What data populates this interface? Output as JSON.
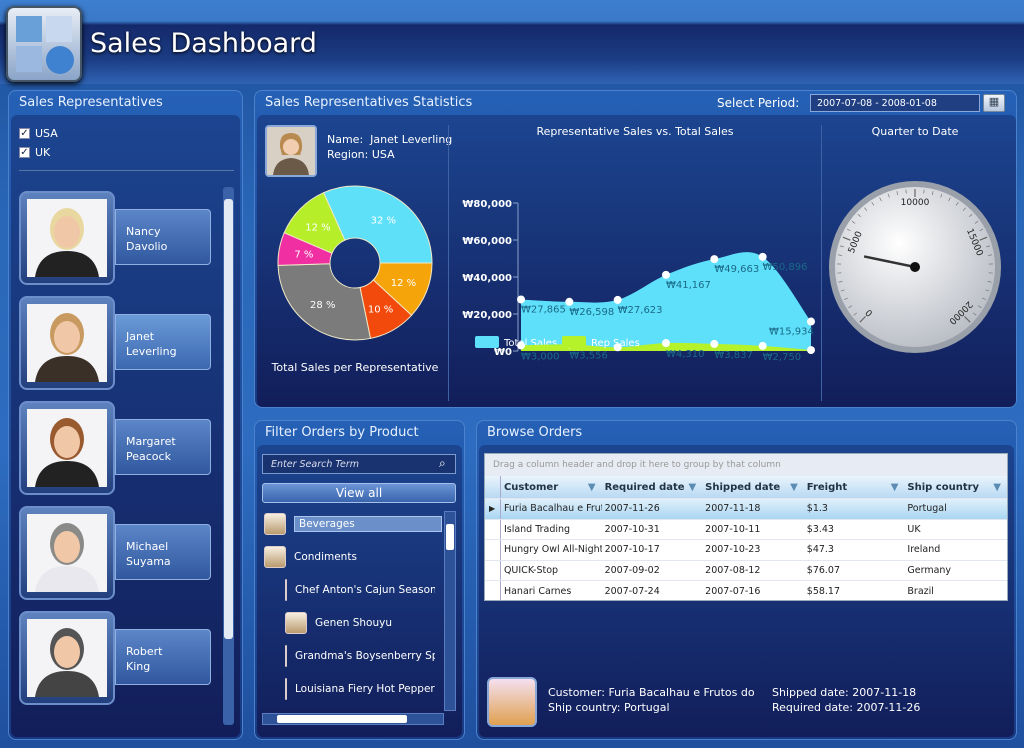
{
  "app": {
    "title": "Sales Dashboard"
  },
  "reps_panel": {
    "title": "Sales Representatives",
    "filters": [
      {
        "label": "USA",
        "checked": true
      },
      {
        "label": "UK",
        "checked": true
      }
    ],
    "reps": [
      {
        "first": "Nancy",
        "last": "Davolio"
      },
      {
        "first": "Janet",
        "last": "Leverling",
        "selected": true
      },
      {
        "first": "Margaret",
        "last": "Peacock"
      },
      {
        "first": "Michael",
        "last": "Suyama"
      },
      {
        "first": "Robert",
        "last": "King"
      }
    ]
  },
  "stats": {
    "title": "Sales Representatives Statistics",
    "period_label": "Select Period:",
    "period_value": "2007-07-08 - 2008-01-08",
    "name_label": "Name:",
    "name": "Janet Leverling",
    "region_label": "Region:",
    "region": "USA",
    "pie_caption": "Total Sales per Representative",
    "gauge_title": "Quarter to Date"
  },
  "chart_data": [
    {
      "type": "pie",
      "title": "Total Sales per Representative",
      "donut": true,
      "slices": [
        {
          "label": "32 %",
          "value": 32,
          "color": "#5ee0f8"
        },
        {
          "label": "12 %",
          "value": 12,
          "color": "#f5a40a"
        },
        {
          "label": "10 %",
          "value": 10,
          "color": "#f24a0c"
        },
        {
          "label": "28 %",
          "value": 28,
          "color": "#7b7b7b"
        },
        {
          "label": "7 %",
          "value": 7,
          "color": "#ef2fa2"
        },
        {
          "label": "12 %",
          "value": 12,
          "color": "#b6ee2a"
        }
      ]
    },
    {
      "type": "area",
      "title": "Representative Sales vs. Total Sales",
      "ylim": [
        0,
        80000
      ],
      "yticks": [
        "₩0",
        "₩20,000",
        "₩40,000",
        "₩60,000",
        "₩80,000"
      ],
      "series": [
        {
          "name": "Total Sales",
          "color": "#5fe0fa",
          "values": [
            27865,
            26598,
            27623,
            41167,
            49663,
            50896,
            15934
          ],
          "labels": [
            "₩27,865",
            "₩26,598",
            "₩27,623",
            "₩41,167",
            "₩49,663",
            "₩50,896",
            "₩15,934"
          ]
        },
        {
          "name": "Rep Sales",
          "color": "#b6f22a",
          "values": [
            3000,
            3556,
            2000,
            4310,
            3837,
            2750,
            500
          ],
          "labels": [
            "₩3,000",
            "₩3,556",
            "",
            "₩4,310",
            "₩3,837",
            "₩2,750",
            ""
          ]
        }
      ]
    },
    {
      "type": "gauge",
      "title": "Quarter to Date",
      "min": 0,
      "max": 20000,
      "ticks": [
        "0",
        "5000",
        "10000",
        "15000",
        "20000"
      ],
      "value": 4200
    }
  ],
  "filter": {
    "title": "Filter Orders by Product",
    "search_placeholder": "Enter Search Term",
    "view_all": "View all",
    "items": [
      {
        "label": "Beverages",
        "level": 0,
        "selected": true
      },
      {
        "label": "Condiments",
        "level": 0
      },
      {
        "label": "Chef Anton's Cajun Seasoning",
        "level": 1
      },
      {
        "label": "Genen Shouyu",
        "level": 1
      },
      {
        "label": "Grandma's Boysenberry Spread",
        "level": 1
      },
      {
        "label": "Louisiana Fiery Hot Pepper Sauce",
        "level": 1
      }
    ]
  },
  "orders": {
    "title": "Browse Orders",
    "group_hint": "Drag a column header and drop it here to group by that column",
    "columns": [
      "Customer",
      "Required date",
      "Shipped date",
      "Freight",
      "Ship country"
    ],
    "rows": [
      [
        "Furia Bacalhau e Frutos do Mar",
        "2007-11-26",
        "2007-11-18",
        "$1.3",
        "Portugal"
      ],
      [
        "Island Trading",
        "2007-10-31",
        "2007-10-11",
        "$3.43",
        "UK"
      ],
      [
        "Hungry Owl All-Night Grocers",
        "2007-10-17",
        "2007-10-23",
        "$47.3",
        "Ireland"
      ],
      [
        "QUICK-Stop",
        "2007-09-02",
        "2007-08-12",
        "$76.07",
        "Germany"
      ],
      [
        "Hanari Carnes",
        "2007-07-24",
        "2007-07-16",
        "$58.17",
        "Brazil"
      ]
    ],
    "detail": {
      "customer_label": "Customer:",
      "customer": "Furia Bacalhau e Frutos do Mar",
      "country_label": "Ship country:",
      "country": "Portugal",
      "shipped_label": "Shipped date:",
      "shipped": "2007-11-18",
      "required_label": "Required date:",
      "required": "2007-11-26"
    }
  }
}
